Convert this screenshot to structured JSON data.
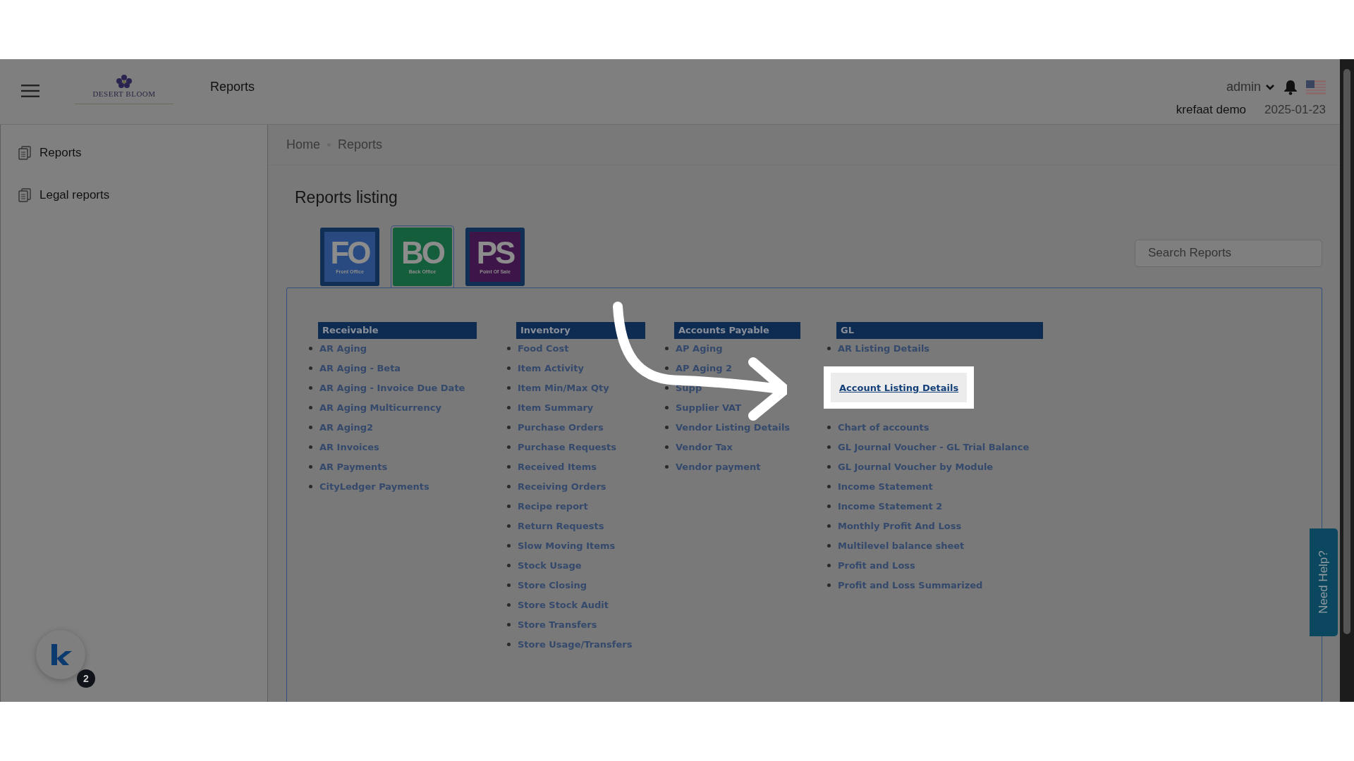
{
  "logo": {
    "text": "DESERT BLOOM"
  },
  "page_title": "Reports",
  "user": {
    "name": "admin"
  },
  "company": "krefaat demo",
  "date": "2025-01-23",
  "sidebar": {
    "items": [
      {
        "label": "Reports"
      },
      {
        "label": "Legal reports"
      }
    ]
  },
  "breadcrumb": [
    "Home",
    "Reports"
  ],
  "section_title": "Reports listing",
  "modules": [
    {
      "code": "FO",
      "caption": "Front Office",
      "color": "#284a80",
      "selected": false
    },
    {
      "code": "BO",
      "caption": "Back Office",
      "color": "#155e3c",
      "selected": true
    },
    {
      "code": "PS",
      "caption": "Point Of Sale",
      "color": "#3e1548",
      "selected": false
    }
  ],
  "search": {
    "placeholder": "Search Reports"
  },
  "groups": [
    {
      "title": "Receivable",
      "items": [
        {
          "kind": "link",
          "label": "AR Aging"
        },
        {
          "kind": "link",
          "label": "AR Aging - Beta"
        },
        {
          "kind": "link",
          "label": "AR Aging - Invoice Due Date"
        },
        {
          "kind": "link",
          "label": "AR Aging Multicurrency"
        },
        {
          "kind": "link",
          "label": "AR Aging2"
        },
        {
          "kind": "link",
          "label": "AR Invoices"
        },
        {
          "kind": "link",
          "label": "AR Payments"
        },
        {
          "kind": "link",
          "label": "CityLedger Payments"
        }
      ]
    },
    {
      "title": "Inventory",
      "items": [
        {
          "kind": "link",
          "label": "Food Cost"
        },
        {
          "kind": "link",
          "label": "Item Activity"
        },
        {
          "kind": "link",
          "label": "Item Min/Max Qty"
        },
        {
          "kind": "link",
          "label": "Item Summary"
        },
        {
          "kind": "link",
          "label": "Purchase Orders"
        },
        {
          "kind": "link",
          "label": "Purchase Requests"
        },
        {
          "kind": "link",
          "label": "Received Items"
        },
        {
          "kind": "link",
          "label": "Receiving Orders"
        },
        {
          "kind": "link",
          "label": "Recipe report"
        },
        {
          "kind": "link",
          "label": "Return Requests"
        },
        {
          "kind": "link",
          "label": "Slow Moving Items"
        },
        {
          "kind": "link",
          "label": "Stock Usage"
        },
        {
          "kind": "link",
          "label": "Store Closing"
        },
        {
          "kind": "link",
          "label": "Store Stock Audit"
        },
        {
          "kind": "link",
          "label": "Store Transfers"
        },
        {
          "kind": "link",
          "label": "Store Usage/Transfers"
        }
      ]
    },
    {
      "title": "Accounts Payable",
      "items": [
        {
          "kind": "link",
          "label": "AP Aging"
        },
        {
          "kind": "link",
          "label": "AP Aging 2"
        },
        {
          "kind": "link",
          "label": "Supp"
        },
        {
          "kind": "link",
          "label": "Supplier VAT"
        },
        {
          "kind": "link",
          "label": "Vendor Listing Details"
        },
        {
          "kind": "link",
          "label": "Vendor Tax"
        },
        {
          "kind": "link",
          "label": "Vendor payment"
        }
      ]
    },
    {
      "title": "GL",
      "items": [
        {
          "kind": "link",
          "label": "AR Listing Details"
        },
        {
          "kind": "highlight",
          "label": "Account Listing Details"
        },
        {
          "kind": "link",
          "label": "Chart of accounts"
        },
        {
          "kind": "link",
          "label": "GL Journal Voucher - GL Trial Balance"
        },
        {
          "kind": "link",
          "label": "GL Journal Voucher by Module"
        },
        {
          "kind": "link",
          "label": "Income Statement"
        },
        {
          "kind": "link",
          "label": "Income Statement 2"
        },
        {
          "kind": "link",
          "label": "Monthly Profit And Loss"
        },
        {
          "kind": "link",
          "label": "Multilevel balance sheet"
        },
        {
          "kind": "link",
          "label": "Profit and Loss"
        },
        {
          "kind": "link",
          "label": "Profit and Loss Summarized"
        }
      ]
    }
  ],
  "help_tab": "Need Help?",
  "chat_badge": "2"
}
